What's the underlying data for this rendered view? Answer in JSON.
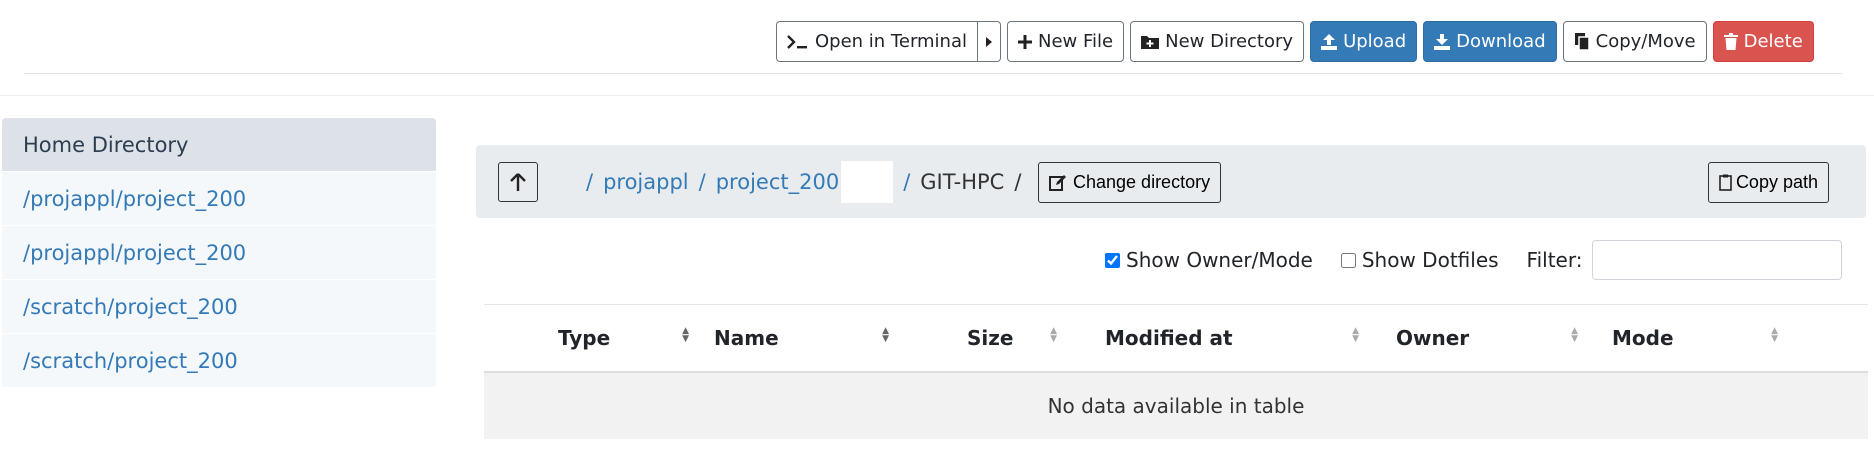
{
  "toolbar": {
    "terminal": "Open in Terminal",
    "new_file": "New File",
    "new_directory": "New Directory",
    "upload": "Upload",
    "download": "Download",
    "copy_move": "Copy/Move",
    "delete": "Delete",
    "colors": {
      "primary": "#337ab7",
      "danger": "#d9534f"
    }
  },
  "sidebar": {
    "items": [
      {
        "label": "Home Directory"
      },
      {
        "label": "/projappl/project_200"
      },
      {
        "label": "/projappl/project_200"
      },
      {
        "label": "/scratch/project_200"
      },
      {
        "label": "/scratch/project_200"
      }
    ]
  },
  "path": {
    "crumbs": [
      "projappl",
      "project_200",
      "GIT-HPC"
    ],
    "sep": "/",
    "change_dir": "Change directory",
    "copy_path": "Copy path"
  },
  "options": {
    "show_owner_mode": "Show Owner/Mode",
    "show_dotfiles": "Show Dotfiles",
    "filter_label": "Filter:",
    "filter_value": ""
  },
  "table": {
    "columns": [
      "Type",
      "Name",
      "Size",
      "Modified at",
      "Owner",
      "Mode"
    ],
    "empty": "No data available in table"
  }
}
